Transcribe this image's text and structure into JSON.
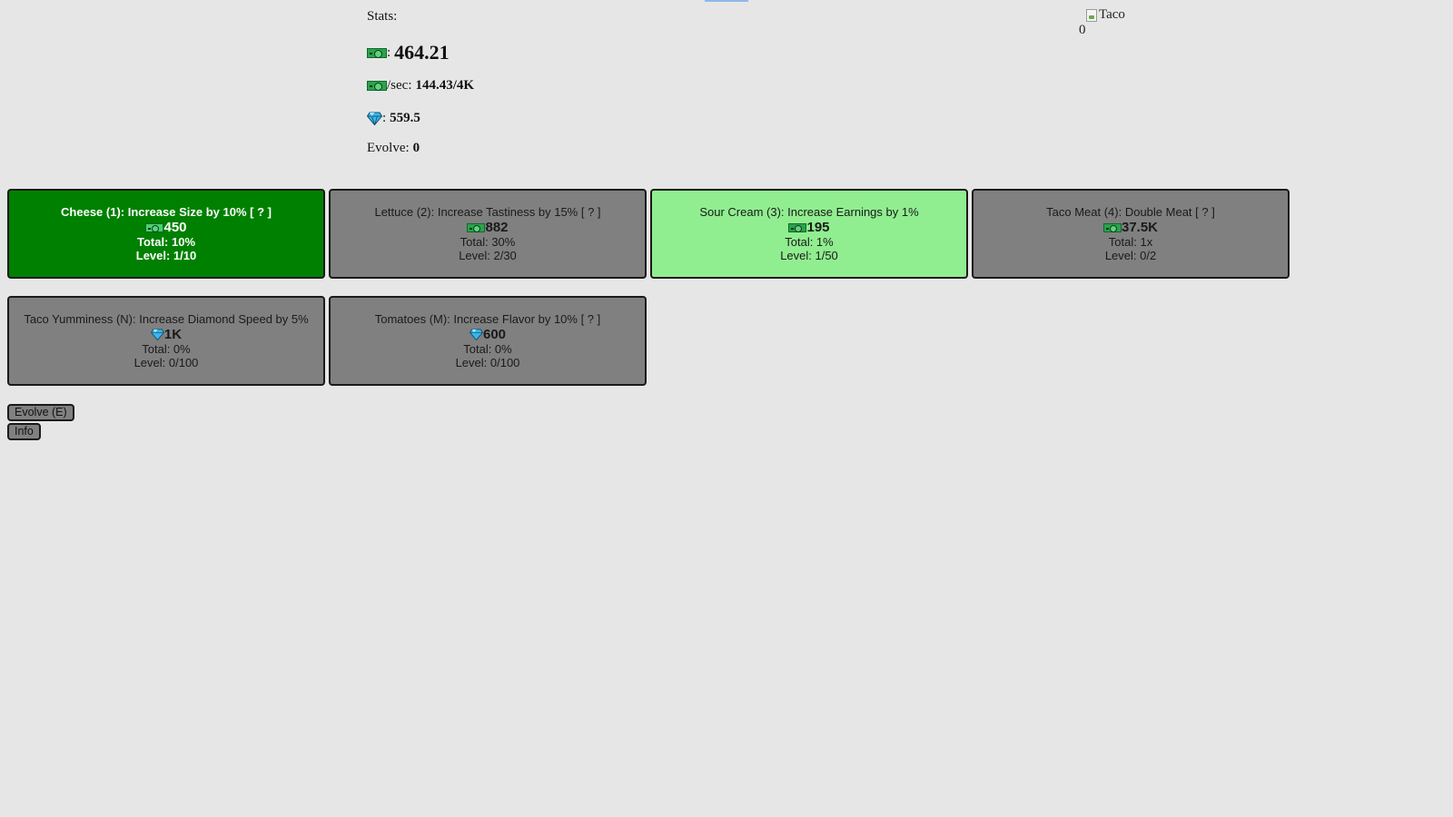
{
  "stats": {
    "title": "Stats:",
    "money_label": ":",
    "money_value": "464.21",
    "per_sec_label": "/sec:",
    "per_sec_value": "144.43/4K",
    "diamond_label": ":",
    "diamond_value": "559.5",
    "evolve_label": "Evolve:",
    "evolve_value": "0"
  },
  "taco": {
    "image_alt": "Taco",
    "count": "0"
  },
  "upgrades": [
    {
      "title": "Cheese (1): Increase Size by 10% [ ? ]",
      "currency": "money",
      "cost": "450",
      "total": "Total: 10%",
      "level": "Level: 1/10",
      "state": "active"
    },
    {
      "title": "Lettuce (2): Increase Tastiness by 15% [ ? ]",
      "currency": "money",
      "cost": "882",
      "total": "Total: 30%",
      "level": "Level: 2/30",
      "state": "locked"
    },
    {
      "title": "Sour Cream (3): Increase Earnings by 1%",
      "currency": "money",
      "cost": "195",
      "total": "Total: 1%",
      "level": "Level: 1/50",
      "state": "affordable"
    },
    {
      "title": "Taco Meat (4): Double Meat [ ? ]",
      "currency": "money",
      "cost": "37.5K",
      "total": "Total: 1x",
      "level": "Level: 0/2",
      "state": "locked"
    },
    {
      "title": "Taco Yumminess (N): Increase Diamond Speed by 5%",
      "currency": "diamond",
      "cost": "1K",
      "total": "Total: 0%",
      "level": "Level: 0/100",
      "state": "locked"
    },
    {
      "title": "Tomatoes (M): Increase Flavor by 10% [ ? ]",
      "currency": "diamond",
      "cost": "600",
      "total": "Total: 0%",
      "level": "Level: 0/100",
      "state": "locked"
    }
  ],
  "buttons": {
    "evolve": "Evolve (E)",
    "info": "Info"
  },
  "colors": {
    "background": "#e6e6e6",
    "active_upgrade": "#008000",
    "affordable_upgrade": "#90ee90",
    "locked_upgrade": "#808080",
    "money_icon": "#2fa14c",
    "diamond_icon": "#3ab6e8"
  },
  "icons": {
    "money": "money-bill-icon",
    "diamond": "diamond-icon"
  }
}
